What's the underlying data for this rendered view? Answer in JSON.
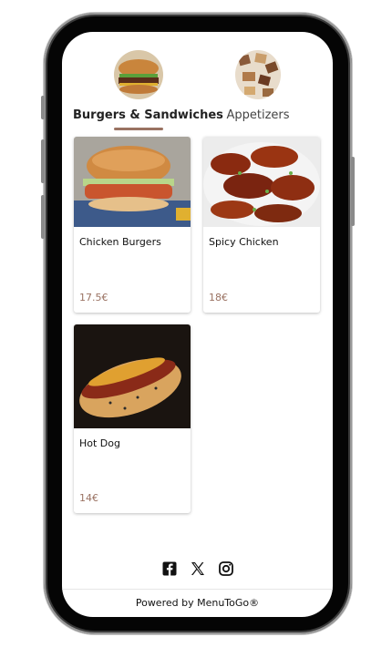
{
  "categories": [
    {
      "label": "Burgers & Sandwiches",
      "selected": true,
      "icon": "burger-image"
    },
    {
      "label": "Appetizers",
      "selected": false,
      "icon": "appetizers-image"
    }
  ],
  "items": [
    {
      "title": "Chicken Burgers",
      "price": "17.5€",
      "icon": "chicken-burger-image"
    },
    {
      "title": "Spicy Chicken",
      "price": "18€",
      "icon": "spicy-chicken-image"
    },
    {
      "title": "Hot Dog",
      "price": "14€",
      "icon": "hot-dog-image"
    }
  ],
  "social": [
    "facebook-icon",
    "x-icon",
    "instagram-icon"
  ],
  "footer": {
    "powered_by": "Powered by MenuToGo®"
  },
  "colors": {
    "accent": "#9a7262",
    "frame": "#050505",
    "background": "#ffffff"
  }
}
